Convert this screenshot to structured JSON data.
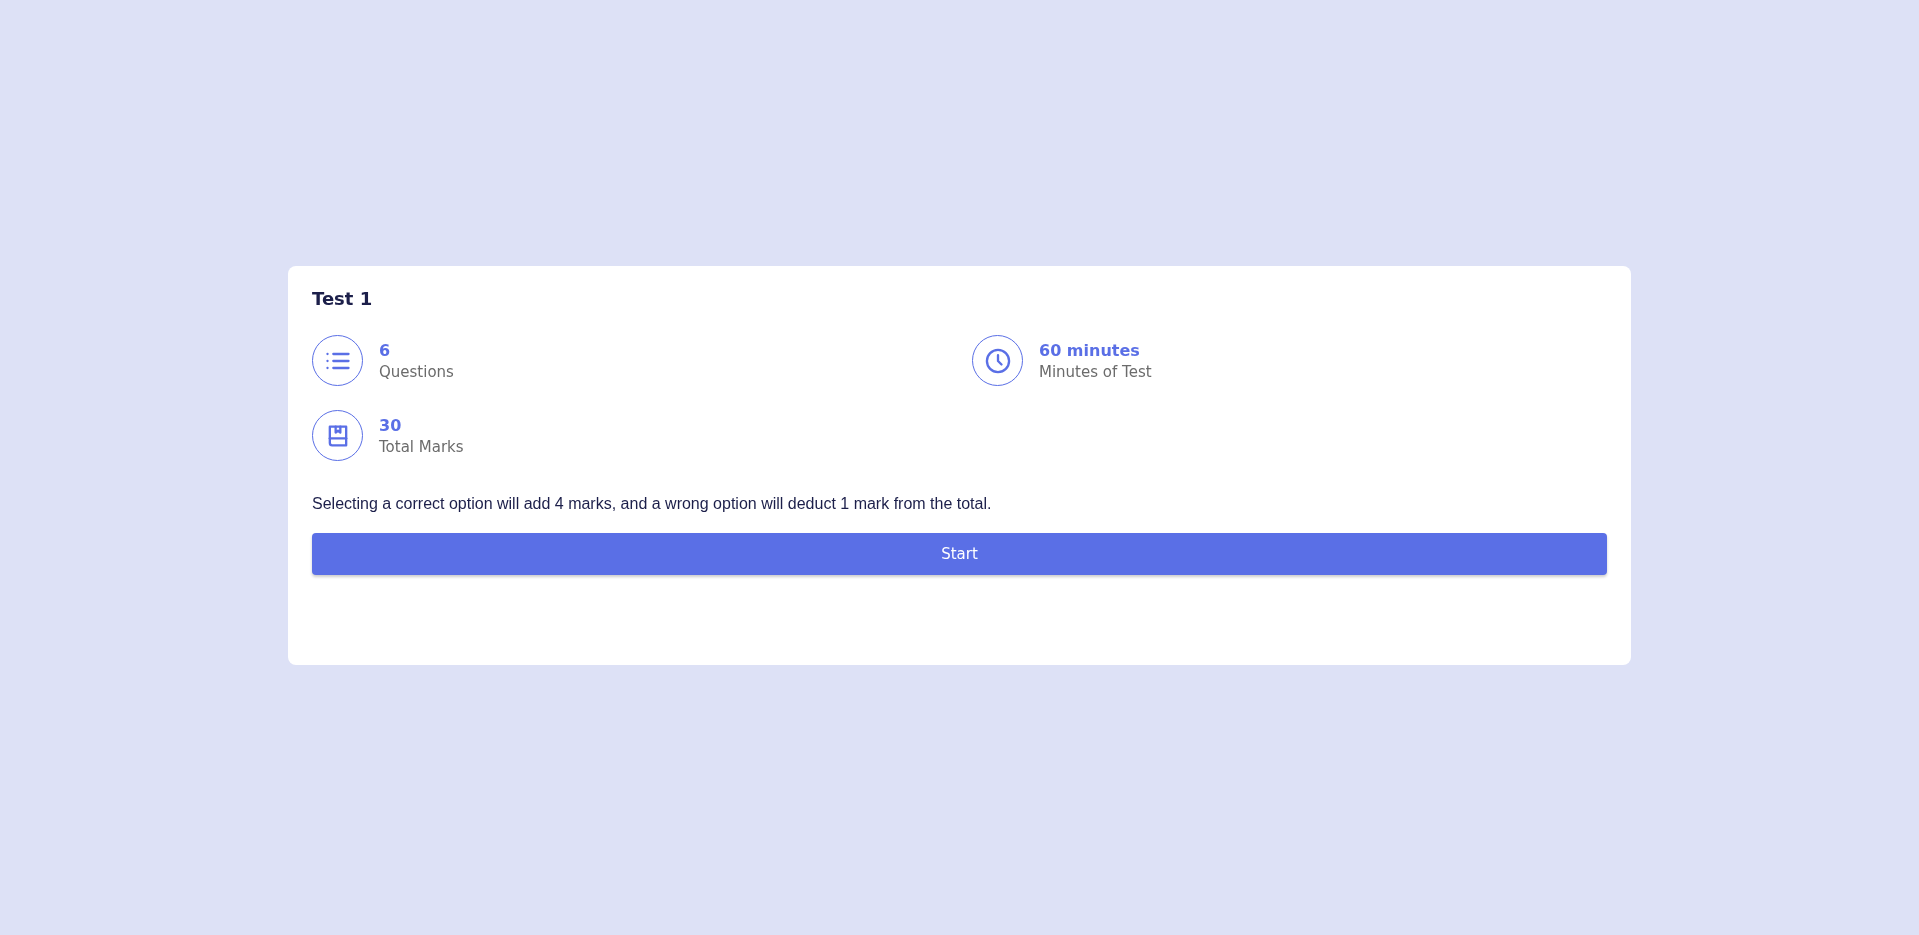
{
  "test": {
    "title": "Test 1",
    "stats": [
      {
        "kind": "list",
        "value": "6",
        "label": "Questions"
      },
      {
        "kind": "clock",
        "value": "60 minutes",
        "label": "Minutes of Test"
      },
      {
        "kind": "book",
        "value": "30",
        "label": "Total Marks"
      }
    ],
    "description": "Selecting a correct option will add 4 marks, and a wrong option will deduct 1 mark from the total.",
    "button": "Start"
  }
}
